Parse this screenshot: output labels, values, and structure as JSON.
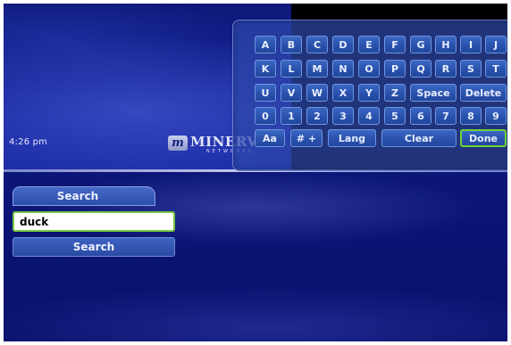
{
  "status": {
    "time": "4:26 pm"
  },
  "logo": {
    "badge": "m",
    "word": "MINERVA",
    "sub": "NETWORKS"
  },
  "keyboard": {
    "rows": [
      [
        "A",
        "B",
        "C",
        "D",
        "E",
        "F",
        "G",
        "H",
        "I",
        "J"
      ],
      [
        "K",
        "L",
        "M",
        "N",
        "O",
        "P",
        "Q",
        "R",
        "S",
        "T"
      ],
      [
        "U",
        "V",
        "W",
        "X",
        "Y",
        "Z",
        "Space",
        "Delete"
      ],
      [
        "0",
        "1",
        "2",
        "3",
        "4",
        "5",
        "6",
        "7",
        "8",
        "9"
      ],
      [
        "Aa",
        "# +",
        "Lang",
        "Clear",
        "Done"
      ]
    ],
    "selected_key": "Done"
  },
  "search": {
    "tab_label": "Search",
    "input_value": "duck",
    "button_label": "Search"
  },
  "colors": {
    "background": "#0b1678",
    "key_fill": "#2a52ad",
    "key_border": "#6f95df",
    "focus_green": "#6ed33a"
  }
}
